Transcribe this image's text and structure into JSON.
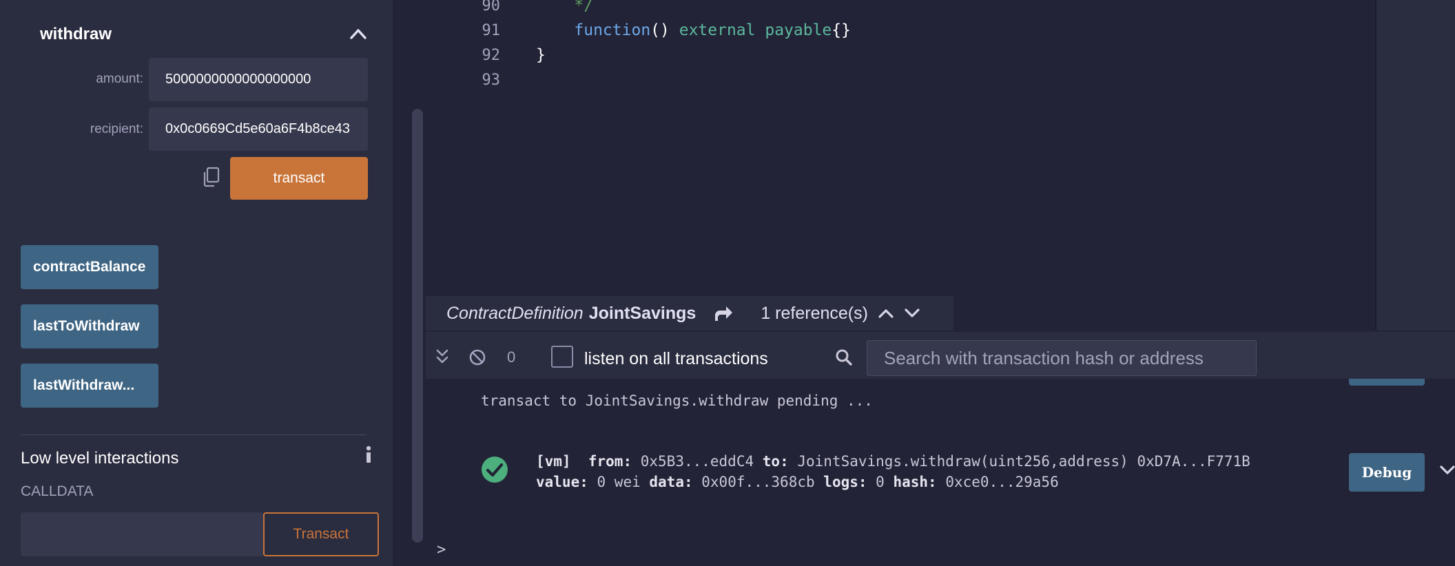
{
  "left_panel": {
    "function_title": "withdraw",
    "params": [
      {
        "label": "amount:",
        "value": "5000000000000000000"
      },
      {
        "label": "recipient:",
        "value": "0x0c0669Cd5e60a6F4b8ce43"
      }
    ],
    "transact_label": "transact",
    "call_buttons": [
      "contractBalance",
      "lastToWithdraw",
      "lastWithdraw..."
    ],
    "low_level_title": "Low level interactions",
    "calldata_label": "CALLDATA",
    "calldata_value": "",
    "low_level_transact_label": "Transact"
  },
  "editor": {
    "lines": [
      {
        "no": "90",
        "segments": [
          {
            "text": "    */",
            "cls": "c-comment"
          }
        ]
      },
      {
        "no": "91",
        "segments": [
          {
            "text": "    ",
            "cls": "c-plain"
          },
          {
            "text": "function",
            "cls": "c-func"
          },
          {
            "text": "() ",
            "cls": "c-plain"
          },
          {
            "text": "external payable",
            "cls": "c-kw"
          },
          {
            "text": "{}",
            "cls": "c-plain"
          }
        ]
      },
      {
        "no": "92",
        "segments": [
          {
            "text": "}",
            "cls": "c-plain"
          }
        ]
      },
      {
        "no": "93",
        "segments": []
      }
    ]
  },
  "reference_bar": {
    "kind": "ContractDefinition",
    "name": "JointSavings",
    "count": "1 reference(s)"
  },
  "terminal": {
    "pending_count": "0",
    "listen_label": "listen on all transactions",
    "listen_checked": false,
    "search_placeholder": "Search with transaction hash or address",
    "pending_line": "transact to JointSavings.withdraw pending ...",
    "tx": {
      "env": "[vm]",
      "from_label": "from:",
      "from": "0x5B3...eddC4",
      "to_label": "to:",
      "to": "JointSavings.withdraw(uint256,address) 0xD7A...F771B",
      "value_label": "value:",
      "value": "0 wei",
      "data_label": "data:",
      "data": "0x00f...368cb",
      "logs_label": "logs:",
      "logs": "0",
      "hash_label": "hash:",
      "hash": "0xce0...29a56"
    },
    "debug_label": "Debug",
    "prompt": ">"
  },
  "colors": {
    "panel_bg": "#2a2c3f",
    "editor_bg": "#222336",
    "input_bg": "#36384d",
    "accent_orange": "#c97539",
    "button_blue": "#3f6584",
    "success_green": "#4caf7d"
  }
}
